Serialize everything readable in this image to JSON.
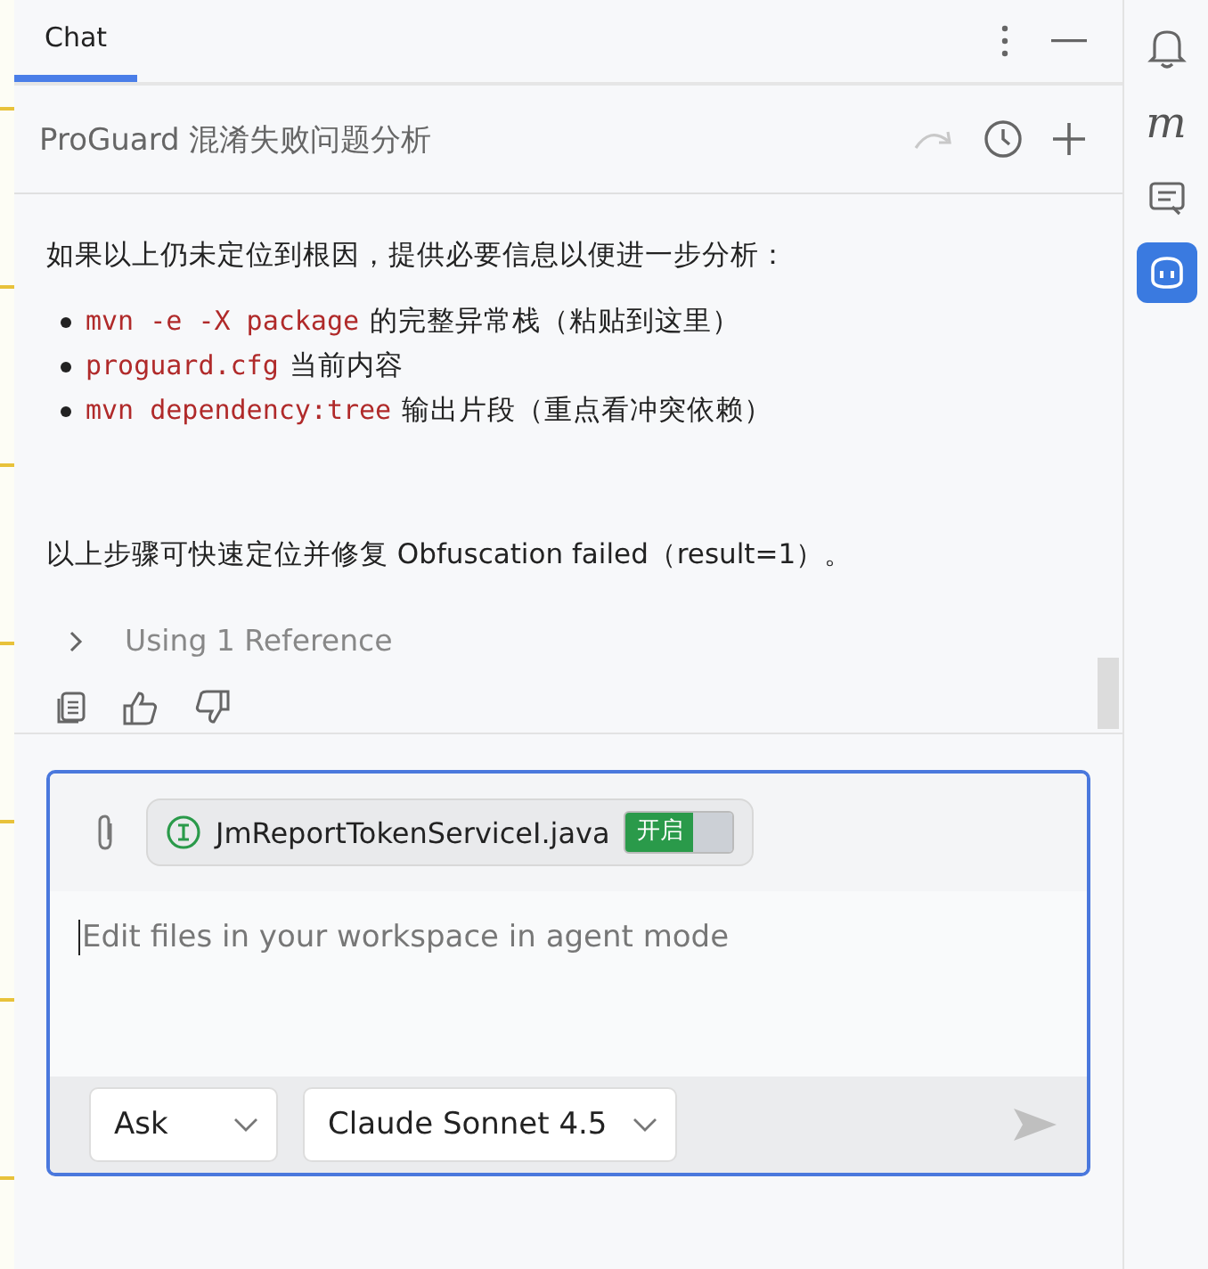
{
  "tabs": [
    {
      "label": "Chat",
      "selected": true
    }
  ],
  "conversation": {
    "title": "ProGuard 混淆失败问题分析"
  },
  "message": {
    "intro": "如果以上仍未定位到根因，提供必要信息以便进一步分析：",
    "bullets": [
      {
        "code": "mvn -e -X package",
        "text": "的完整异常栈（粘贴到这里）"
      },
      {
        "code": "proguard.cfg",
        "text": "当前内容"
      },
      {
        "code": "mvn dependency:tree",
        "text": "输出片段（重点看冲突依赖）"
      }
    ],
    "conclusion": "以上步骤可快速定位并修复 Obfuscation failed（result=1）。",
    "reference": {
      "label": "Using 1 Reference",
      "expanded": false
    }
  },
  "input": {
    "attachment": {
      "file": "JmReportTokenServiceI.java",
      "toggle_label": "开启",
      "on": true
    },
    "placeholder": "Edit files in your workspace in agent mode",
    "mode": "Ask",
    "model": "Claude Sonnet 4.5"
  },
  "sidebar": [
    {
      "kind": "bell",
      "selected": false
    },
    {
      "kind": "glyph",
      "glyph": "m",
      "selected": false
    },
    {
      "kind": "notes",
      "selected": false
    },
    {
      "kind": "copilot",
      "selected": true
    }
  ]
}
